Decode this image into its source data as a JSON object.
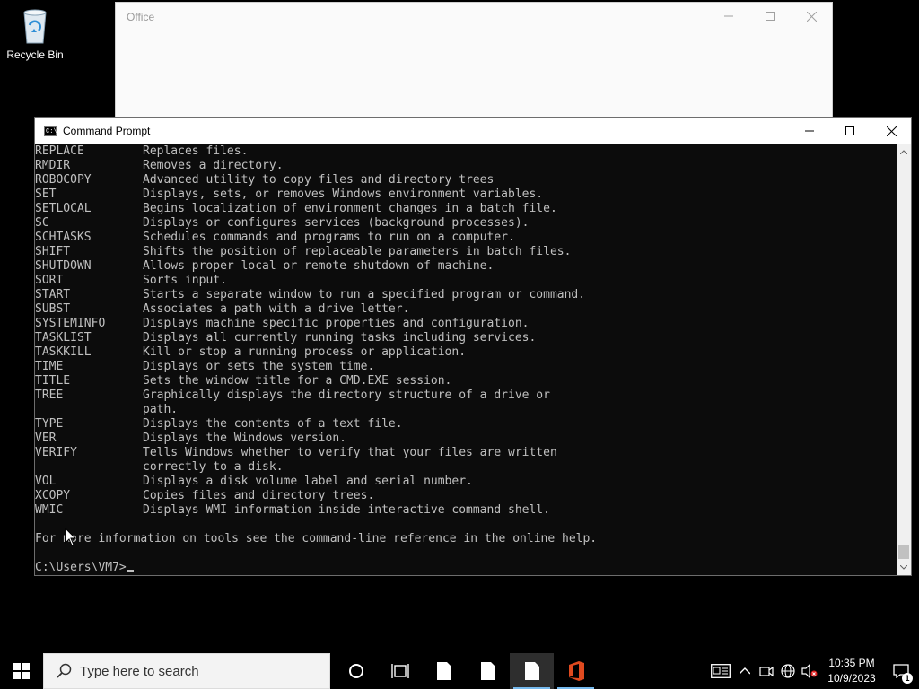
{
  "desktop": {
    "recycle_bin_label": "Recycle Bin"
  },
  "office_window": {
    "title": "Office"
  },
  "cmd_window": {
    "title": "Command Prompt",
    "title_icon_text": "C:\\",
    "lines": [
      {
        "cmd": "REPLACE",
        "desc": "Replaces files."
      },
      {
        "cmd": "RMDIR",
        "desc": "Removes a directory."
      },
      {
        "cmd": "ROBOCOPY",
        "desc": "Advanced utility to copy files and directory trees"
      },
      {
        "cmd": "SET",
        "desc": "Displays, sets, or removes Windows environment variables."
      },
      {
        "cmd": "SETLOCAL",
        "desc": "Begins localization of environment changes in a batch file."
      },
      {
        "cmd": "SC",
        "desc": "Displays or configures services (background processes)."
      },
      {
        "cmd": "SCHTASKS",
        "desc": "Schedules commands and programs to run on a computer."
      },
      {
        "cmd": "SHIFT",
        "desc": "Shifts the position of replaceable parameters in batch files."
      },
      {
        "cmd": "SHUTDOWN",
        "desc": "Allows proper local or remote shutdown of machine."
      },
      {
        "cmd": "SORT",
        "desc": "Sorts input."
      },
      {
        "cmd": "START",
        "desc": "Starts a separate window to run a specified program or command."
      },
      {
        "cmd": "SUBST",
        "desc": "Associates a path with a drive letter."
      },
      {
        "cmd": "SYSTEMINFO",
        "desc": "Displays machine specific properties and configuration."
      },
      {
        "cmd": "TASKLIST",
        "desc": "Displays all currently running tasks including services."
      },
      {
        "cmd": "TASKKILL",
        "desc": "Kill or stop a running process or application."
      },
      {
        "cmd": "TIME",
        "desc": "Displays or sets the system time."
      },
      {
        "cmd": "TITLE",
        "desc": "Sets the window title for a CMD.EXE session."
      },
      {
        "cmd": "TREE",
        "desc": "Graphically displays the directory structure of a drive or"
      },
      {
        "cmd": "",
        "desc": "path."
      },
      {
        "cmd": "TYPE",
        "desc": "Displays the contents of a text file."
      },
      {
        "cmd": "VER",
        "desc": "Displays the Windows version."
      },
      {
        "cmd": "VERIFY",
        "desc": "Tells Windows whether to verify that your files are written"
      },
      {
        "cmd": "",
        "desc": "correctly to a disk."
      },
      {
        "cmd": "VOL",
        "desc": "Displays a disk volume label and serial number."
      },
      {
        "cmd": "XCOPY",
        "desc": "Copies files and directory trees."
      },
      {
        "cmd": "WMIC",
        "desc": "Displays WMI information inside interactive command shell."
      }
    ],
    "footer_text": "For more information on tools see the command-line reference in the online help.",
    "prompt": "C:\\Users\\VM7>"
  },
  "taskbar": {
    "search_placeholder": "Type here to search",
    "time": "10:35 PM",
    "date": "10/9/2023",
    "notification_count": "1"
  }
}
